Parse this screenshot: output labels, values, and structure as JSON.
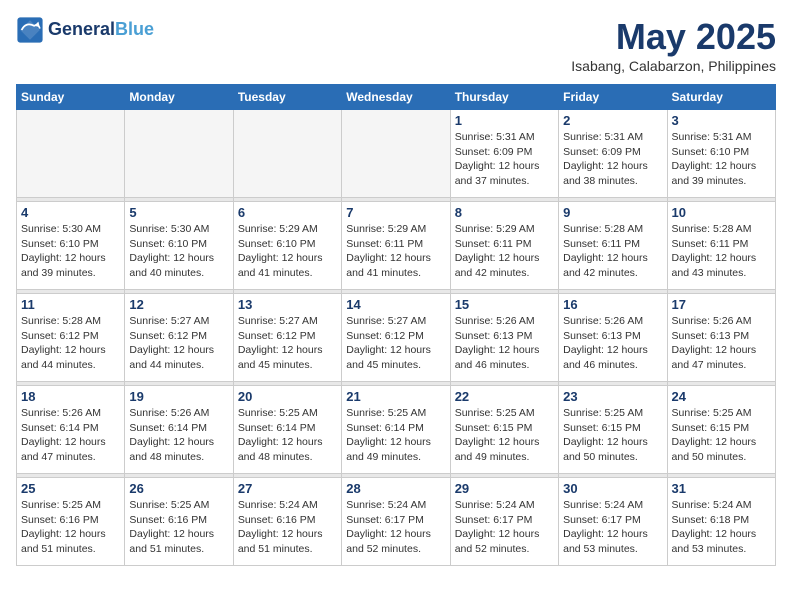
{
  "logo": {
    "line1": "General",
    "line2": "Blue"
  },
  "title": "May 2025",
  "subtitle": "Isabang, Calabarzon, Philippines",
  "days_of_week": [
    "Sunday",
    "Monday",
    "Tuesday",
    "Wednesday",
    "Thursday",
    "Friday",
    "Saturday"
  ],
  "weeks": [
    [
      {
        "day": "",
        "info": ""
      },
      {
        "day": "",
        "info": ""
      },
      {
        "day": "",
        "info": ""
      },
      {
        "day": "",
        "info": ""
      },
      {
        "day": "1",
        "info": "Sunrise: 5:31 AM\nSunset: 6:09 PM\nDaylight: 12 hours\nand 37 minutes."
      },
      {
        "day": "2",
        "info": "Sunrise: 5:31 AM\nSunset: 6:09 PM\nDaylight: 12 hours\nand 38 minutes."
      },
      {
        "day": "3",
        "info": "Sunrise: 5:31 AM\nSunset: 6:10 PM\nDaylight: 12 hours\nand 39 minutes."
      }
    ],
    [
      {
        "day": "4",
        "info": "Sunrise: 5:30 AM\nSunset: 6:10 PM\nDaylight: 12 hours\nand 39 minutes."
      },
      {
        "day": "5",
        "info": "Sunrise: 5:30 AM\nSunset: 6:10 PM\nDaylight: 12 hours\nand 40 minutes."
      },
      {
        "day": "6",
        "info": "Sunrise: 5:29 AM\nSunset: 6:10 PM\nDaylight: 12 hours\nand 41 minutes."
      },
      {
        "day": "7",
        "info": "Sunrise: 5:29 AM\nSunset: 6:11 PM\nDaylight: 12 hours\nand 41 minutes."
      },
      {
        "day": "8",
        "info": "Sunrise: 5:29 AM\nSunset: 6:11 PM\nDaylight: 12 hours\nand 42 minutes."
      },
      {
        "day": "9",
        "info": "Sunrise: 5:28 AM\nSunset: 6:11 PM\nDaylight: 12 hours\nand 42 minutes."
      },
      {
        "day": "10",
        "info": "Sunrise: 5:28 AM\nSunset: 6:11 PM\nDaylight: 12 hours\nand 43 minutes."
      }
    ],
    [
      {
        "day": "11",
        "info": "Sunrise: 5:28 AM\nSunset: 6:12 PM\nDaylight: 12 hours\nand 44 minutes."
      },
      {
        "day": "12",
        "info": "Sunrise: 5:27 AM\nSunset: 6:12 PM\nDaylight: 12 hours\nand 44 minutes."
      },
      {
        "day": "13",
        "info": "Sunrise: 5:27 AM\nSunset: 6:12 PM\nDaylight: 12 hours\nand 45 minutes."
      },
      {
        "day": "14",
        "info": "Sunrise: 5:27 AM\nSunset: 6:12 PM\nDaylight: 12 hours\nand 45 minutes."
      },
      {
        "day": "15",
        "info": "Sunrise: 5:26 AM\nSunset: 6:13 PM\nDaylight: 12 hours\nand 46 minutes."
      },
      {
        "day": "16",
        "info": "Sunrise: 5:26 AM\nSunset: 6:13 PM\nDaylight: 12 hours\nand 46 minutes."
      },
      {
        "day": "17",
        "info": "Sunrise: 5:26 AM\nSunset: 6:13 PM\nDaylight: 12 hours\nand 47 minutes."
      }
    ],
    [
      {
        "day": "18",
        "info": "Sunrise: 5:26 AM\nSunset: 6:14 PM\nDaylight: 12 hours\nand 47 minutes."
      },
      {
        "day": "19",
        "info": "Sunrise: 5:26 AM\nSunset: 6:14 PM\nDaylight: 12 hours\nand 48 minutes."
      },
      {
        "day": "20",
        "info": "Sunrise: 5:25 AM\nSunset: 6:14 PM\nDaylight: 12 hours\nand 48 minutes."
      },
      {
        "day": "21",
        "info": "Sunrise: 5:25 AM\nSunset: 6:14 PM\nDaylight: 12 hours\nand 49 minutes."
      },
      {
        "day": "22",
        "info": "Sunrise: 5:25 AM\nSunset: 6:15 PM\nDaylight: 12 hours\nand 49 minutes."
      },
      {
        "day": "23",
        "info": "Sunrise: 5:25 AM\nSunset: 6:15 PM\nDaylight: 12 hours\nand 50 minutes."
      },
      {
        "day": "24",
        "info": "Sunrise: 5:25 AM\nSunset: 6:15 PM\nDaylight: 12 hours\nand 50 minutes."
      }
    ],
    [
      {
        "day": "25",
        "info": "Sunrise: 5:25 AM\nSunset: 6:16 PM\nDaylight: 12 hours\nand 51 minutes."
      },
      {
        "day": "26",
        "info": "Sunrise: 5:25 AM\nSunset: 6:16 PM\nDaylight: 12 hours\nand 51 minutes."
      },
      {
        "day": "27",
        "info": "Sunrise: 5:24 AM\nSunset: 6:16 PM\nDaylight: 12 hours\nand 51 minutes."
      },
      {
        "day": "28",
        "info": "Sunrise: 5:24 AM\nSunset: 6:17 PM\nDaylight: 12 hours\nand 52 minutes."
      },
      {
        "day": "29",
        "info": "Sunrise: 5:24 AM\nSunset: 6:17 PM\nDaylight: 12 hours\nand 52 minutes."
      },
      {
        "day": "30",
        "info": "Sunrise: 5:24 AM\nSunset: 6:17 PM\nDaylight: 12 hours\nand 53 minutes."
      },
      {
        "day": "31",
        "info": "Sunrise: 5:24 AM\nSunset: 6:18 PM\nDaylight: 12 hours\nand 53 minutes."
      }
    ]
  ]
}
